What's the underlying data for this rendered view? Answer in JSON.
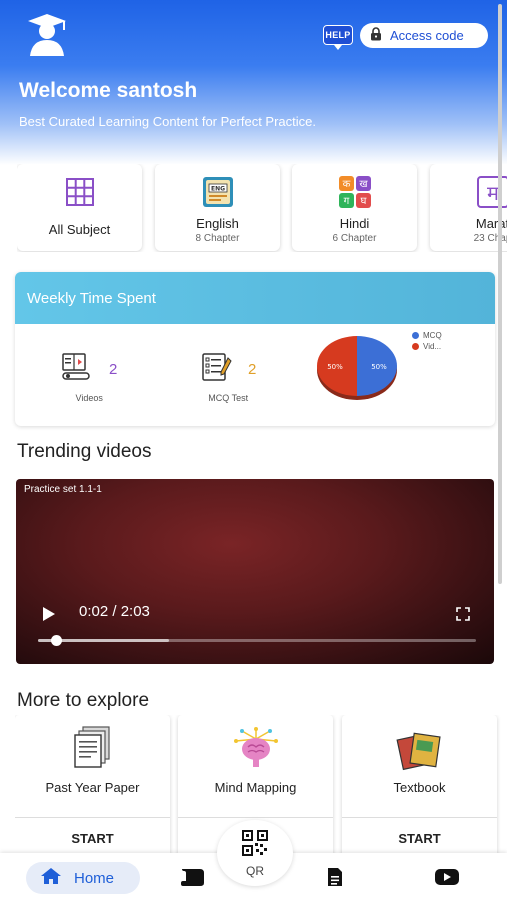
{
  "header": {
    "help_label": "HELP",
    "access_code_label": "Access code",
    "welcome": "Welcome santosh",
    "tagline": "Best Curated Learning Content for Perfect Practice."
  },
  "subjects": [
    {
      "name": "All Subject",
      "chapters": "",
      "icon": "grid-icon"
    },
    {
      "name": "English",
      "chapters": "8 Chapter",
      "icon": "english-book-icon"
    },
    {
      "name": "Hindi",
      "chapters": "6 Chapter",
      "icon": "hindi-letters-icon"
    },
    {
      "name": "Marat",
      "chapters": "23 Chap",
      "icon": "marathi-letter-icon"
    }
  ],
  "weekly": {
    "title": "Weekly Time Spent",
    "videos_count": "2",
    "videos_label": "Videos",
    "mcq_count": "2",
    "mcq_label": "MCQ Test",
    "pie": {
      "slices": [
        {
          "name": "MCQ",
          "value": 50,
          "label": "50%",
          "color": "#3c6fd6"
        },
        {
          "name": "Vid...",
          "value": 50,
          "label": "50%",
          "color": "#d63a1f"
        }
      ]
    }
  },
  "trending": {
    "title": "Trending videos",
    "video_title": "Practice set 1.1-1",
    "time": "0:02 / 2:03",
    "buffered_fraction": 0.3,
    "played_fraction": 0.02
  },
  "explore": {
    "title": "More to explore",
    "items": [
      {
        "name": "Past Year Paper",
        "action": "START",
        "icon": "papers-icon"
      },
      {
        "name": "Mind Mapping",
        "action": "",
        "icon": "brain-icon"
      },
      {
        "name": "Textbook",
        "action": "START",
        "icon": "textbook-icon"
      }
    ]
  },
  "nav": {
    "home_label": "Home",
    "qr_label": "QR"
  },
  "colors": {
    "brand_blue": "#1f63e6",
    "weekly_header": "#5bbde2",
    "videos_count": "#8a4fc7",
    "mcq_count": "#e0a02a"
  }
}
